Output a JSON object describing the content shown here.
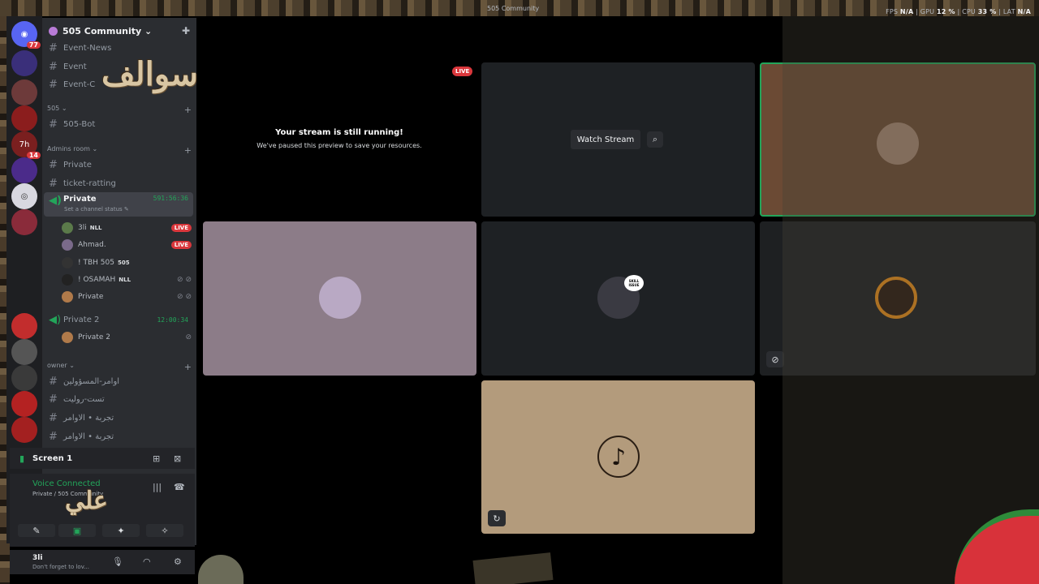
{
  "stage": {
    "title": "505 Community"
  },
  "stats": {
    "fps_label": "FPS",
    "fps_val": "N/A",
    "gpu_label": "GPU",
    "gpu_val": "12 %",
    "cpu_label": "CPU",
    "cpu_val": "33 %",
    "lat_label": "LAT",
    "lat_val": "N/A"
  },
  "rail": {
    "badge_main": "77",
    "badge_7": "14"
  },
  "guild": {
    "name": "505 Community ⌄"
  },
  "channels": {
    "event_news": "Event-News",
    "event": "Event",
    "event_c": "Event-C",
    "cat_505": "505 ⌄",
    "bot": "505-Bot",
    "cat_admins": "Admins room ⌄",
    "private": "Private",
    "ticket": "ticket-ratting",
    "voice_private": "Private",
    "voice_private_timer": "591:56:36",
    "voice_private_status": "Set a channel status ✎",
    "voice_private2": "Private 2",
    "voice_private2_timer": "12:00:34",
    "cat_owner": "owner ⌄",
    "ar1": "اوامر-المسؤولين",
    "ar2": "تست-روليت",
    "ar3": "تجربة • الاوامر",
    "ar4": "تجربة • الاوامر"
  },
  "voice_users": [
    {
      "name": "3li",
      "tag": "NLL",
      "live": "LIVE"
    },
    {
      "name": "Ahmad.",
      "live": "LIVE"
    },
    {
      "name": "! TBH 505",
      "tag": "505"
    },
    {
      "name": "! OSAMAH",
      "tag": "NLL"
    },
    {
      "name": "Private"
    },
    {
      "name": "Private 2"
    }
  ],
  "screen_panel": {
    "label": "Screen 1"
  },
  "voice_panel": {
    "title": "Voice Connected",
    "sub": "Private / 505 Community"
  },
  "user": {
    "name": "3li",
    "status": "Don't forget to lov..."
  },
  "tiles": {
    "paused_title": "Your stream is still running!",
    "paused_sub": "We've paused this preview to save your resources.",
    "live": "LIVE",
    "watch": "Watch Stream",
    "skill": "SKILL ISSUE"
  },
  "decor": {
    "arabic_1": "سوالف",
    "arabic_2": "علي"
  },
  "colors": {
    "accent_green": "#23a55a",
    "live_red": "#da373c",
    "sidebar": "#2b2d31",
    "panel": "#232428"
  },
  "icons": [
    "discord-icon",
    "add-member-icon",
    "hash-icon",
    "speaker-icon",
    "mic-icon",
    "headphones-icon",
    "gear-icon",
    "music-note-icon",
    "search-icon"
  ]
}
